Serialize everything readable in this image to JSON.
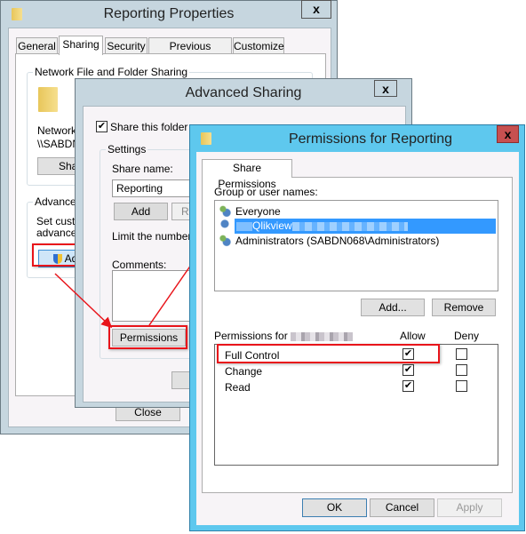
{
  "properties_window": {
    "title": "Reporting Properties",
    "close": "x",
    "tabs": [
      {
        "label": "General"
      },
      {
        "label": "Sharing"
      },
      {
        "label": "Security"
      },
      {
        "label": "Previous Versions"
      },
      {
        "label": "Customize"
      }
    ],
    "network_group": {
      "legend": "Network File and Folder Sharing",
      "name_partial": "Network P",
      "path_partial": "\\\\SABDN",
      "share_button": "Share"
    },
    "advanced_group": {
      "legend": "Advanced",
      "desc1": "Set custo",
      "desc2": "advanced",
      "button": "Adv"
    },
    "close_button": "Close"
  },
  "advanced_window": {
    "title": "Advanced Sharing",
    "close": "x",
    "share_checkbox": {
      "label": "Share this folder",
      "checked": true
    },
    "settings_legend": "Settings",
    "share_name_label": "Share name:",
    "share_name_value": "Reporting",
    "add_button": "Add",
    "remove_button_partial": "Re",
    "limit_label": "Limit the number o",
    "comments_label": "Comments:",
    "permissions_button": "Permissions"
  },
  "permissions_window": {
    "title": "Permissions for Reporting",
    "close": "x",
    "tab": "Share Permissions",
    "group_label": "Group or user names:",
    "users": [
      {
        "name": "Everyone",
        "icon": "group-icon"
      },
      {
        "name": "Qlikview",
        "icon": "user-icon",
        "selected": true
      },
      {
        "name": "Administrators (SABDN068\\Administrators)",
        "icon": "group-icon"
      }
    ],
    "add_button": "Add...",
    "remove_button": "Remove",
    "permissions_for_label": "Permissions for",
    "allow_header": "Allow",
    "deny_header": "Deny",
    "permissions": [
      {
        "name": "Full Control",
        "allow": true,
        "deny": false
      },
      {
        "name": "Change",
        "allow": true,
        "deny": false
      },
      {
        "name": "Read",
        "allow": true,
        "deny": false
      }
    ],
    "ok_button": "OK",
    "cancel_button": "Cancel",
    "apply_button": "Apply"
  },
  "colors": {
    "highlight": "#e8141a",
    "active_border": "#5ec8ee",
    "inactive_border": "#c6d6df",
    "selection": "#3399ff"
  }
}
